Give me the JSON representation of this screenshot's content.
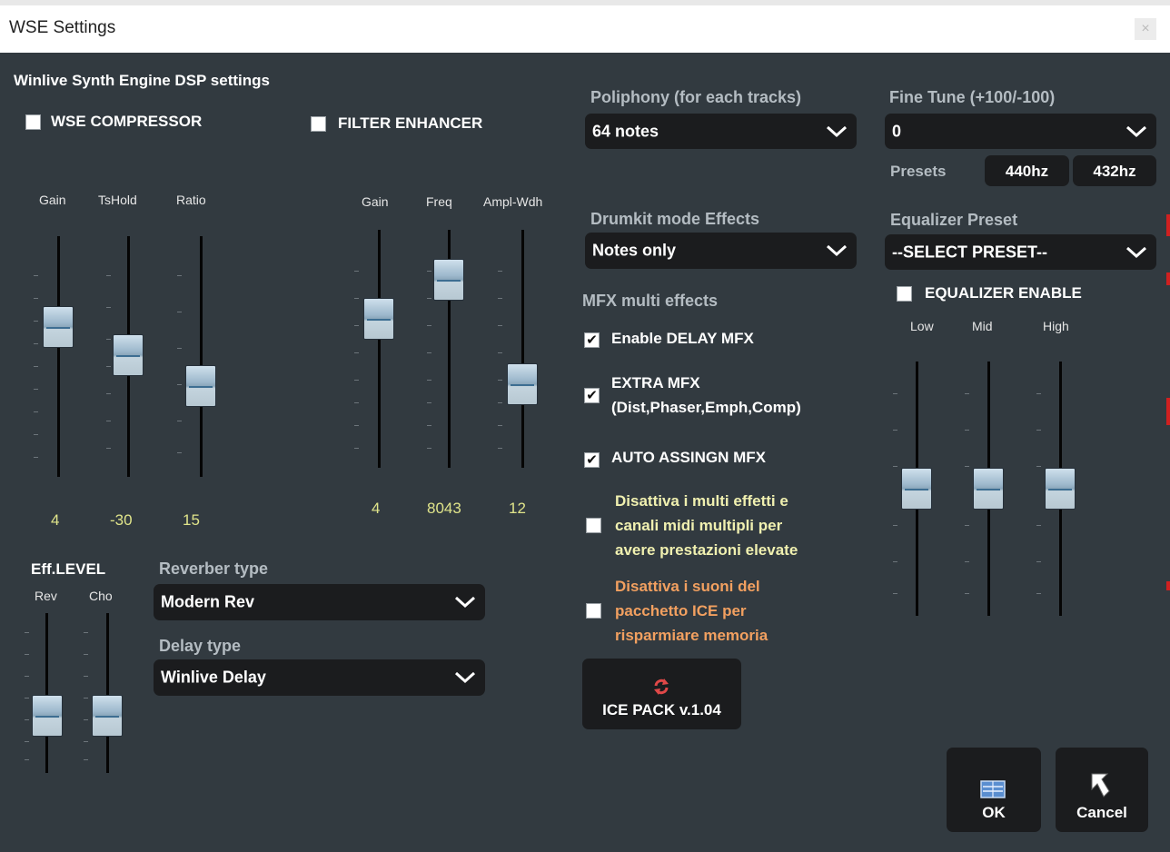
{
  "window": {
    "title": "WSE Settings",
    "close_glyph": "×"
  },
  "dsp": {
    "heading": "Winlive Synth Engine DSP settings",
    "compressor": {
      "label": "WSE COMPRESSOR",
      "checked": false
    },
    "filter": {
      "label": "FILTER ENHANCER",
      "checked": false
    },
    "compressor_sliders": [
      {
        "label": "Gain",
        "value": "4"
      },
      {
        "label": "TsHold",
        "value": "-30"
      },
      {
        "label": "Ratio",
        "value": "15"
      }
    ],
    "filter_sliders": [
      {
        "label": "Gain",
        "value": "4"
      },
      {
        "label": "Freq",
        "value": "8043"
      },
      {
        "label": "Ampl-Wdh",
        "value": "12"
      }
    ],
    "eff_level": {
      "heading": "Eff.LEVEL",
      "rev_label": "Rev",
      "cho_label": "Cho"
    },
    "reverb": {
      "label": "Reverber type",
      "value": "Modern Rev"
    },
    "delay": {
      "label": "Delay type",
      "value": "Winlive Delay"
    }
  },
  "middle": {
    "poliphony": {
      "label": "Poliphony (for each tracks)",
      "value": "64 notes"
    },
    "drumkit": {
      "label": "Drumkit mode Effects",
      "value": "Notes only"
    },
    "mfx_heading": "MFX multi effects",
    "enable_delay": {
      "label": "Enable DELAY MFX",
      "checked": true
    },
    "extra_mfx": {
      "line1": "EXTRA MFX",
      "line2": "(Dist,Phaser,Emph,Comp)",
      "checked": true
    },
    "auto_assign": {
      "label": "AUTO ASSINGN MFX",
      "checked": true
    },
    "disable_multi": {
      "line1": "Disattiva i multi effetti e",
      "line2": "canali midi multipli per",
      "line3": "avere prestazioni elevate",
      "checked": false
    },
    "disable_ice": {
      "line1": "Disattiva i suoni del",
      "line2": "pacchetto ICE per",
      "line3": "risparmiare memoria",
      "checked": false
    },
    "ice_pack_label": "ICE PACK v.1.04",
    "ice_pack_icon": "refresh-icon"
  },
  "right": {
    "fine_tune": {
      "label": "Fine Tune (+100/-100)",
      "value": "0"
    },
    "presets_label": "Presets",
    "preset_440": "440hz",
    "preset_432": "432hz",
    "equalizer_preset": {
      "label": "Equalizer Preset",
      "value": "--SELECT PRESET--"
    },
    "eq_enable": {
      "label": "EQUALIZER ENABLE",
      "checked": false
    },
    "eq_bands": [
      {
        "label": "Low"
      },
      {
        "label": "Mid"
      },
      {
        "label": "High"
      }
    ]
  },
  "buttons": {
    "ok": "OK",
    "cancel": "Cancel",
    "ok_icon": "keyboard-icon",
    "cancel_icon": "back-arrow-icon"
  },
  "colors": {
    "panel_bg": "#323a40",
    "dropdown_bg": "#1b1c1e",
    "value_yellow": "#e0e48a",
    "warning_orange": "#f2a060"
  }
}
